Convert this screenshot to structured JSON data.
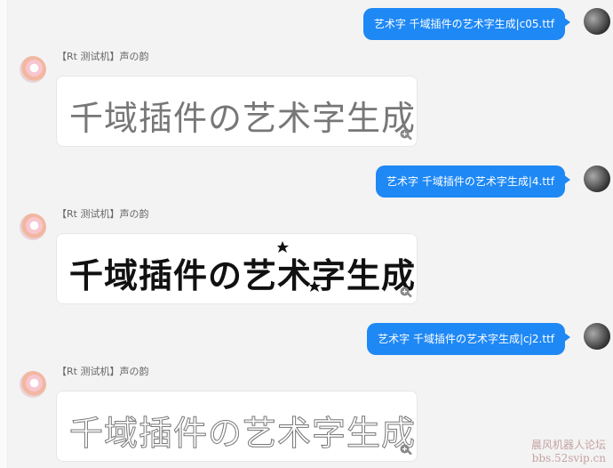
{
  "messages": [
    {
      "outgoing_text": "艺术字 千域插件の艺术字生成|c05.ttf",
      "sender": "【Rt 测试机】声の韵",
      "art_text": "千域插件の艺术字生成"
    },
    {
      "outgoing_text": "艺术字 千域插件の艺术字生成|4.ttf",
      "sender": "【Rt 测试机】声の韵",
      "art_text": "千域插件の艺术字生成"
    },
    {
      "outgoing_text": "艺术字 千域插件の艺术字生成|cj2.ttf",
      "sender": "【Rt 测试机】声の韵",
      "art_text": "千域插件の艺术字生成"
    }
  ],
  "watermark": {
    "line1": "晨风机器人论坛",
    "line2": "bbs.52svip.cn"
  },
  "colors": {
    "bubble": "#1e88f5"
  },
  "icons": {
    "zoom": "zoom-in-icon"
  }
}
